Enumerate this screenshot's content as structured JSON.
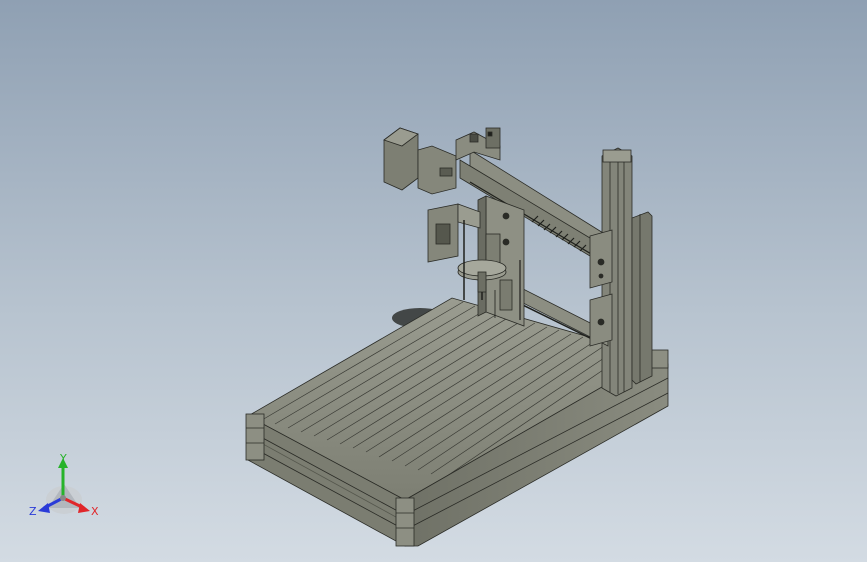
{
  "viewport": {
    "background_top": "#8fa0b3",
    "background_bottom": "#d3dbe3",
    "model_color": "#8a8c80",
    "model_edge_color": "#2a2b26"
  },
  "axis_triad": {
    "x_label": "X",
    "y_label": "Y",
    "z_label": "Z",
    "x_color": "#e0262a",
    "y_color": "#27b32a",
    "z_color": "#2a3bd8"
  }
}
